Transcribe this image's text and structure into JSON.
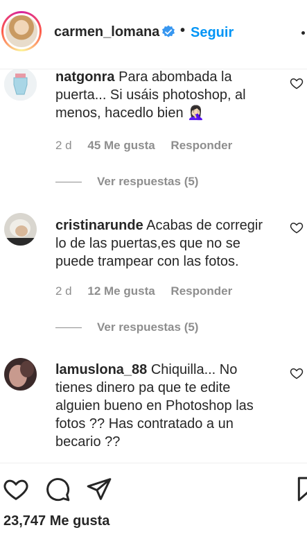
{
  "header": {
    "username": "carmen_lomana",
    "separator": "•",
    "follow_label": "Seguir"
  },
  "comments": [
    {
      "username": "natgonra",
      "text": "Para abombada la puerta... Si usáis photoshop, al menos, hacedlo bien 🤦🏻‍♀️",
      "time": "2 d",
      "likes": "45 Me gusta",
      "reply": "Responder",
      "view_replies": "Ver respuestas (5)"
    },
    {
      "username": "cristinarunde",
      "text": "Acabas de corregir lo de las puertas,es que no se puede trampear con las fotos.",
      "time": "2 d",
      "likes": "12 Me gusta",
      "reply": "Responder",
      "view_replies": "Ver respuestas (5)"
    },
    {
      "username": "lamuslona_88",
      "text": "Chiquilla... No tienes dinero pa que te edite alguien bueno en Photoshop las fotos ?? Has contratado a un becario ??"
    }
  ],
  "footer": {
    "like_count": "23,747 Me gusta"
  },
  "colors": {
    "accent": "#0095f6",
    "verified": "#3897f0",
    "muted": "#8e8e8e",
    "text": "#262626"
  },
  "icons": [
    "verified-badge-icon",
    "heart-outline-icon",
    "comment-bubble-icon",
    "share-paper-plane-icon",
    "bookmark-icon",
    "more-options-icon"
  ]
}
